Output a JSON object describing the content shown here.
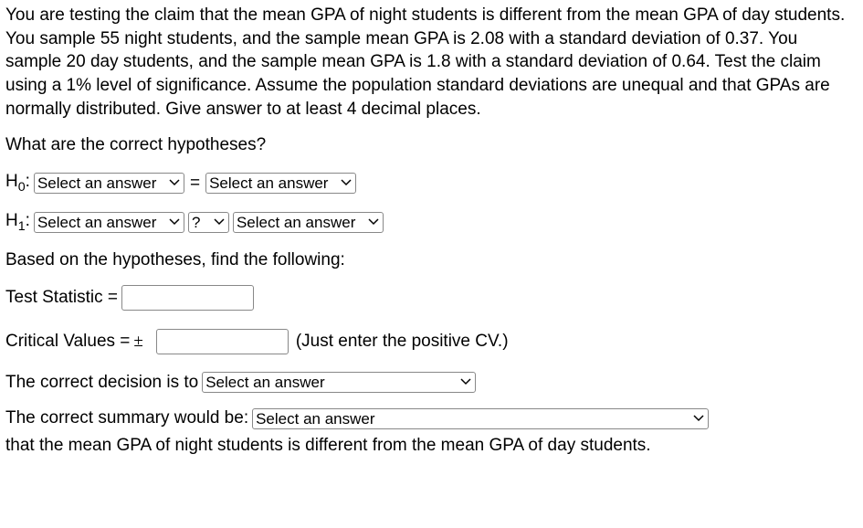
{
  "prompt": "You are testing the claim that the mean GPA of night students is different from the mean GPA of day students. You sample 55 night students, and the sample mean GPA is 2.08 with a standard deviation of 0.37. You sample 20 day students, and the sample mean GPA is 1.8 with a standard deviation of 0.64. Test the claim using a 1% level of significance. Assume the population standard deviations are unequal and that GPAs are normally distributed. Give answer to at least 4 decimal places.",
  "q_hypotheses": "What are the correct hypotheses?",
  "h0": {
    "label_pre": "H",
    "label_sub": "0",
    "label_post": ":",
    "left_placeholder": "Select an answer",
    "op": "=",
    "right_placeholder": "Select an answer"
  },
  "h1": {
    "label_pre": "H",
    "label_sub": "1",
    "label_post": ":",
    "left_placeholder": "Select an answer",
    "op_placeholder": "?",
    "right_placeholder": "Select an answer"
  },
  "based_on": "Based on the hypotheses, find the following:",
  "test_stat": {
    "label": "Test Statistic =",
    "value": ""
  },
  "critical_values": {
    "label_pre": "Critical Values = ",
    "pm": "±",
    "value": "",
    "suffix": "(Just enter the positive CV.)"
  },
  "decision": {
    "label": "The correct decision is to",
    "placeholder": "Select an answer"
  },
  "summary": {
    "label": "The correct summary would be:",
    "placeholder": "Select an answer",
    "suffix": "that the mean GPA of night students is different from the mean GPA of day students."
  }
}
